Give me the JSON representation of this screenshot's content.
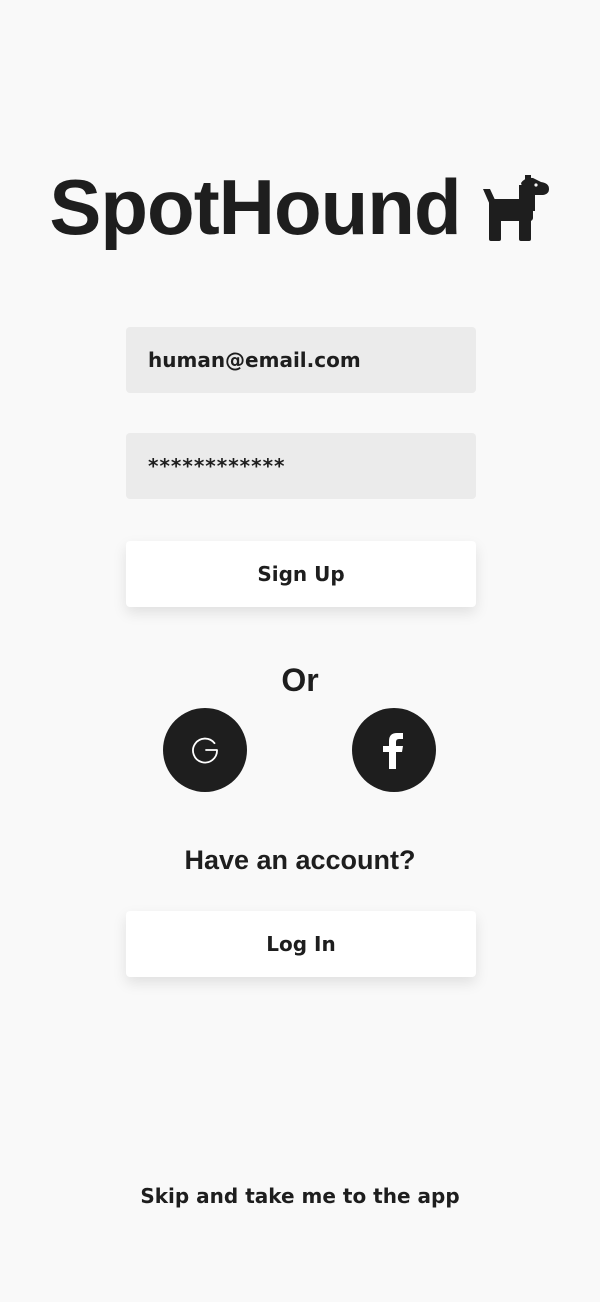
{
  "app": {
    "title": "SpotHound",
    "logo_icon": "dog-icon"
  },
  "form": {
    "email_value": "human@email.com",
    "password_value": "************",
    "signup_label": "Sign Up"
  },
  "divider": {
    "or_label": "Or"
  },
  "social": {
    "google_icon": "google-icon",
    "facebook_icon": "facebook-icon"
  },
  "login": {
    "prompt": "Have an account?",
    "login_label": "Log In"
  },
  "skip": {
    "label": "Skip and take me to the app"
  },
  "colors": {
    "background": "#f9f9f9",
    "text": "#1e1e1e",
    "field": "#ebebeb",
    "button": "#ffffff"
  }
}
